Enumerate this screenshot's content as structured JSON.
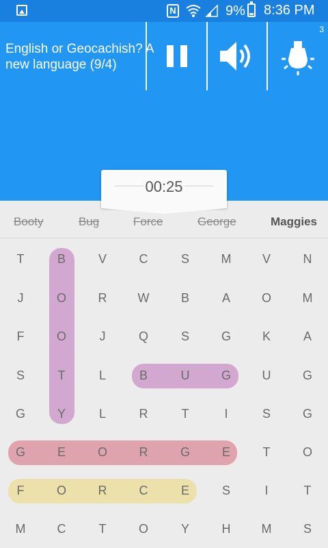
{
  "status_bar": {
    "battery": "9%",
    "time": "8:36 PM"
  },
  "header": {
    "title": "English or Geocachish? A new language (9/4)",
    "counter": "3"
  },
  "timer": "00:25",
  "words": [
    {
      "text": "Booty",
      "found": true
    },
    {
      "text": "Bug",
      "found": true
    },
    {
      "text": "Force",
      "found": true
    },
    {
      "text": "George",
      "found": true
    },
    {
      "text": "Maggies",
      "found": false
    }
  ],
  "grid": [
    [
      "T",
      "B",
      "V",
      "C",
      "S",
      "M",
      "V",
      "N"
    ],
    [
      "J",
      "O",
      "R",
      "W",
      "B",
      "A",
      "O",
      "M"
    ],
    [
      "F",
      "O",
      "J",
      "Q",
      "S",
      "G",
      "K",
      "A"
    ],
    [
      "S",
      "T",
      "L",
      "B",
      "U",
      "G",
      "U",
      "G"
    ],
    [
      "G",
      "Y",
      "L",
      "R",
      "T",
      "I",
      "S",
      "G"
    ],
    [
      "G",
      "E",
      "O",
      "R",
      "G",
      "E",
      "T",
      "O"
    ],
    [
      "F",
      "O",
      "R",
      "C",
      "E",
      "S",
      "I",
      "T"
    ],
    [
      "M",
      "C",
      "T",
      "O",
      "Y",
      "H",
      "M",
      "S"
    ]
  ],
  "highlights": [
    {
      "word": "BOOTY",
      "color": "#d3a8d0"
    },
    {
      "word": "BUG",
      "color": "#d3a8d0"
    },
    {
      "word": "GEORGE",
      "color": "#dfa3ad"
    },
    {
      "word": "FORCE",
      "color": "#ece0ab"
    }
  ],
  "colors": {
    "status_bar": "#1a80e0",
    "header": "#2196f3"
  }
}
